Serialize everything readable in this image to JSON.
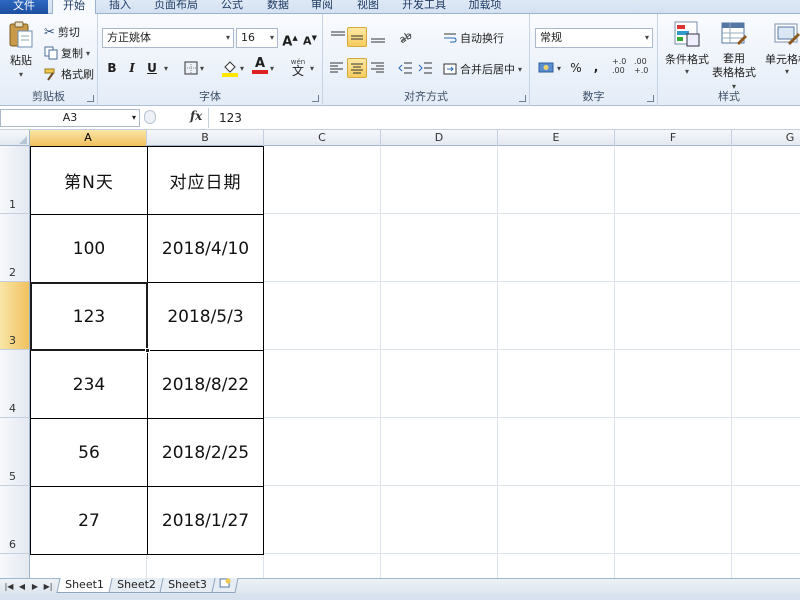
{
  "tabs": [
    {
      "label": "文件",
      "kind": "file"
    },
    {
      "label": "开始",
      "kind": "active"
    },
    {
      "label": "插入"
    },
    {
      "label": "页面布局"
    },
    {
      "label": "公式"
    },
    {
      "label": "数据"
    },
    {
      "label": "审阅"
    },
    {
      "label": "视图"
    },
    {
      "label": "开发工具"
    },
    {
      "label": "加载项"
    }
  ],
  "clipboard": {
    "group_label": "剪贴板",
    "paste": "粘贴",
    "cut": "剪切",
    "copy": "复制",
    "format_painter": "格式刷"
  },
  "font": {
    "group_label": "字体",
    "font_name": "方正姚体",
    "font_size": "16",
    "bold": "B",
    "italic": "I",
    "underline": "U",
    "grow": "A",
    "shrink": "A",
    "font_color_letter": "A",
    "phonetic": "wén",
    "phonetic_char": "文"
  },
  "alignment": {
    "group_label": "对齐方式",
    "wrap_text": "自动换行",
    "merge_center": "合并后居中"
  },
  "number": {
    "group_label": "数字",
    "format": "常规",
    "percent": "%",
    "comma": ",",
    "inc_decimal": "+.0\n.00",
    "dec_decimal": ".00\n+.0"
  },
  "styles": {
    "group_label": "样式",
    "conditional": "条件格式",
    "table_format_1": "套用",
    "table_format_2": "表格格式",
    "cell_styles": "单元格样"
  },
  "formula_bar": {
    "name_box": "A3",
    "fx": "fx",
    "content": "123"
  },
  "columns": [
    "A",
    "B",
    "C",
    "D",
    "E",
    "F",
    "G"
  ],
  "rows": [
    "1",
    "2",
    "3",
    "4",
    "5",
    "6"
  ],
  "table": [
    [
      "第N天",
      "对应日期"
    ],
    [
      "100",
      "2018/4/10"
    ],
    [
      "123",
      "2018/5/3"
    ],
    [
      "234",
      "2018/8/22"
    ],
    [
      "56",
      "2018/2/25"
    ],
    [
      "27",
      "2018/1/27"
    ]
  ],
  "active_cell": {
    "col": "A",
    "row": "3"
  },
  "sheets": [
    "Sheet1",
    "Sheet2",
    "Sheet3"
  ],
  "active_sheet": "Sheet1",
  "colors": {
    "accent_file": "#2f6bc7",
    "selection": "#f1c15f",
    "font_color_bar": "#e02020",
    "highlight_bar": "#ffe600"
  }
}
